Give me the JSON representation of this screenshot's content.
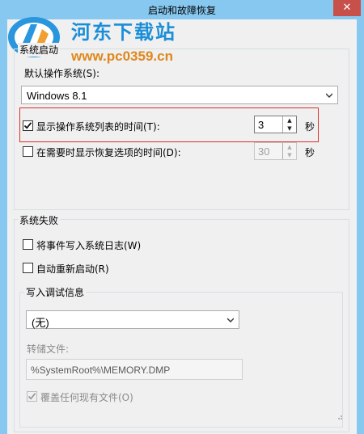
{
  "window": {
    "title": "启动和故障恢复",
    "close_glyph": "✕"
  },
  "watermark": {
    "brand": "河东下载站",
    "url": "www.pc0359.cn"
  },
  "system_startup": {
    "group_title": "系统启动",
    "default_os_label": "默认操作系统(S):",
    "default_os_value": "Windows 8.1",
    "show_os_list_label": "显示操作系统列表的时间(T):",
    "show_os_list_checked": true,
    "show_os_list_value": "3",
    "unit_seconds": "秒",
    "show_recovery_label": "在需要时显示恢复选项的时间(D):",
    "show_recovery_checked": false,
    "show_recovery_value": "30",
    "unit_seconds_2": "秒"
  },
  "system_failure": {
    "group_title": "系统失败",
    "write_event_label": "将事件写入系统日志(W)",
    "write_event_checked": false,
    "auto_restart_label": "自动重新启动(R)",
    "auto_restart_checked": false
  },
  "debug_info": {
    "group_title": "写入调试信息",
    "type_value": "(无)",
    "dump_file_label": "转储文件:",
    "dump_file_value": "%SystemRoot%\\MEMORY.DMP",
    "overwrite_label": "覆盖任何现有文件(O)",
    "overwrite_checked": true
  },
  "colors": {
    "title_bar": "#87c8f0",
    "close_button": "#c7504a",
    "highlight_border": "#d9312d",
    "watermark_blue": "#1a8ed8",
    "watermark_orange": "#e0871c"
  }
}
